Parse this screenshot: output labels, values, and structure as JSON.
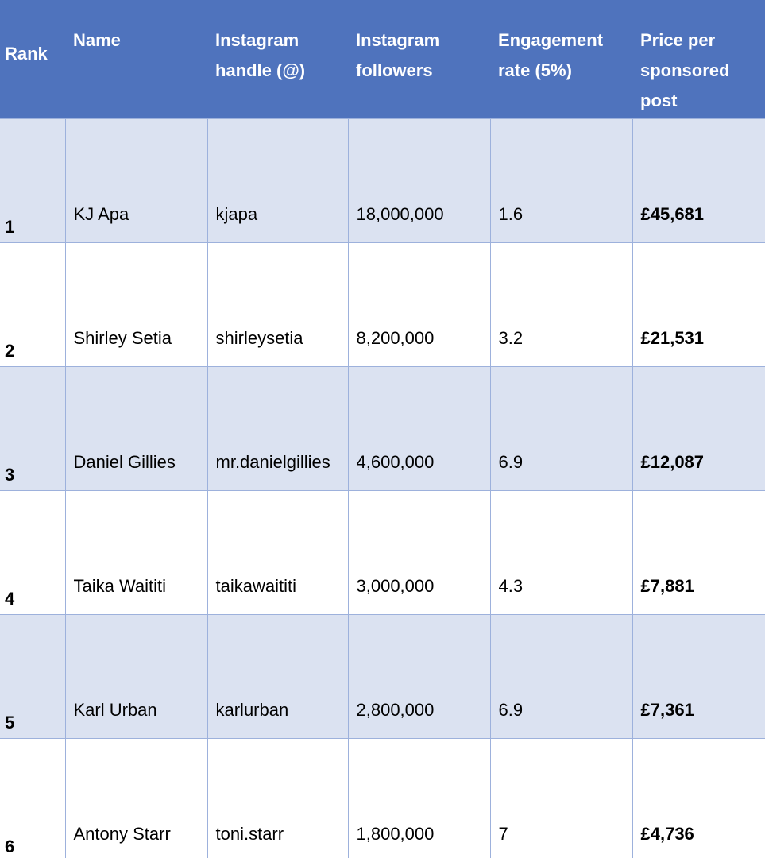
{
  "table": {
    "headers": {
      "rank": "Rank",
      "name": "Name",
      "handle_line1": "Instagram",
      "handle_line2": "handle (@)",
      "followers_line1": "Instagram",
      "followers_line2": "followers",
      "engagement_line1": "Engagement",
      "engagement_line2": "rate (5%)",
      "price_line1": "Price per",
      "price_line2": "sponsored",
      "price_line3": "post"
    },
    "rows": [
      {
        "rank": "1",
        "name": "KJ Apa",
        "handle": "kjapa",
        "followers": "18,000,000",
        "engagement": "1.6",
        "price": "£45,681"
      },
      {
        "rank": "2",
        "name": "Shirley Setia",
        "handle": "shirleysetia",
        "followers": "8,200,000",
        "engagement": "3.2",
        "price": "£21,531"
      },
      {
        "rank": "3",
        "name": "Daniel Gillies",
        "handle": "mr.danielgillies",
        "followers": "4,600,000",
        "engagement": "6.9",
        "price": "£12,087"
      },
      {
        "rank": "4",
        "name": "Taika Waititi",
        "handle": "taikawaititi",
        "followers": "3,000,000",
        "engagement": "4.3",
        "price": "£7,881"
      },
      {
        "rank": "5",
        "name": "Karl Urban",
        "handle": "karlurban",
        "followers": "2,800,000",
        "engagement": "6.9",
        "price": "£7,361"
      },
      {
        "rank": "6",
        "name": "Antony Starr",
        "handle": "toni.starr",
        "followers": "1,800,000",
        "engagement": "7",
        "price": "£4,736"
      }
    ]
  },
  "colors": {
    "header_background": "#4f73bd",
    "header_text": "#ffffff",
    "row_shade": "#dbe2f1",
    "row_plain": "#ffffff",
    "grid_line": "#9db1dc"
  }
}
